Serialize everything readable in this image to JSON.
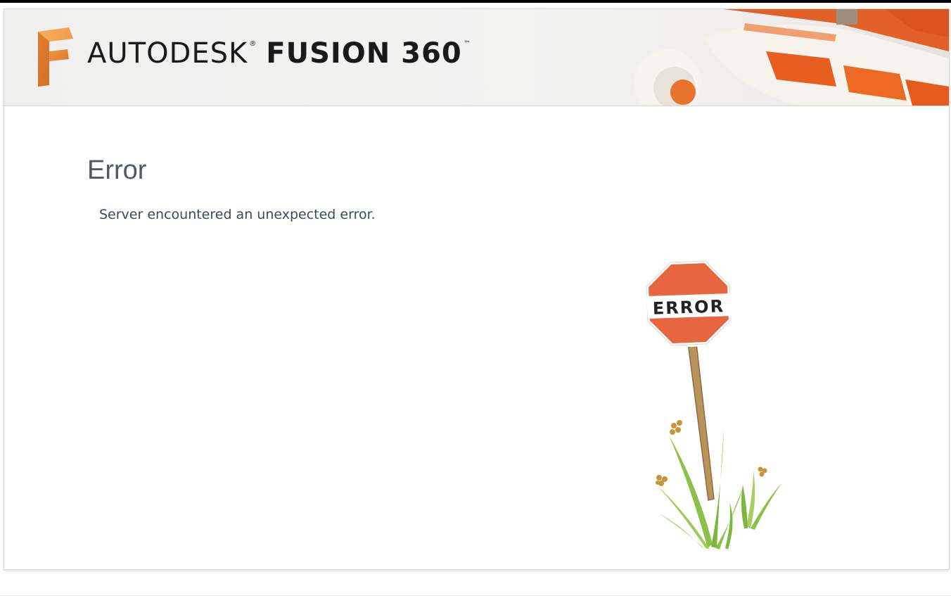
{
  "header": {
    "brand_light": "AUTODESK",
    "brand_registered": "®",
    "brand_bold": "FUSION 360",
    "brand_tm": "™",
    "logo_icon": "fusion-360-logo-icon"
  },
  "error": {
    "title": "Error",
    "message": "Server encountered an unexpected error.",
    "sign_text": "ERROR"
  },
  "colors": {
    "accent_orange": "#e8663f",
    "title_gray": "#4d5a63",
    "message_gray": "#3c4a55",
    "grass_green": "#8cc04a"
  }
}
